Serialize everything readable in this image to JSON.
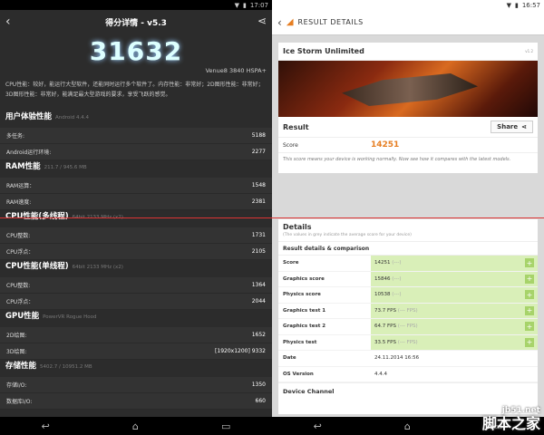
{
  "left": {
    "status_time": "17:07",
    "title": "得分详情 - v5.3",
    "score": "31632",
    "device": "Venue8 3840 HSPA+",
    "description": "CPU性能：较好，能运行大型软件，还能同时运行多个软件了。内存性能：非常好；2D图形性能：非常好；3D图形性能：非常好，能满足最大型游戏的要求，享受飞跃的感觉。",
    "sections": [
      {
        "title": "用户体验性能",
        "sub": "Android 4.4.4",
        "rows": [
          {
            "label": "多任务:",
            "value": "5188"
          },
          {
            "label": "Android运行环境:",
            "value": "2277"
          }
        ]
      },
      {
        "title": "RAM性能",
        "sub": "211.7 / 945.6 MB",
        "rows": [
          {
            "label": "RAM运算：",
            "value": "1548"
          },
          {
            "label": "RAM速度:",
            "value": "2381"
          }
        ]
      },
      {
        "title": "CPU性能(多线程)",
        "sub": "64bit 2133 MHz (x2)",
        "rows": [
          {
            "label": "CPU整数:",
            "value": "1731"
          },
          {
            "label": "CPU浮点：",
            "value": "2105"
          }
        ]
      },
      {
        "title": "CPU性能(单线程)",
        "sub": "64bit 2133 MHz (x2)",
        "rows": [
          {
            "label": "CPU整数:",
            "value": "1364"
          },
          {
            "label": "CPU浮点：",
            "value": "2044"
          }
        ]
      },
      {
        "title": "GPU性能",
        "sub": "PowerVR Rogue Hood",
        "rows": [
          {
            "label": "2D绘图:",
            "value": "1652"
          },
          {
            "label": "3D绘图:",
            "value": "[1920x1200] 9332"
          }
        ]
      },
      {
        "title": "存储性能",
        "sub": "5402.7 / 10951.2 MB",
        "rows": [
          {
            "label": "存储I/O:",
            "value": "1350"
          },
          {
            "label": "数据库I/O:",
            "value": "660"
          }
        ]
      }
    ]
  },
  "right": {
    "status_time": "16:57",
    "title": "RESULT DETAILS",
    "test_name": "Ice Storm Unlimited",
    "test_version": "v1.2",
    "result_label": "Result",
    "share_label": "Share",
    "score_label": "Score",
    "score_value": "14251",
    "score_note": "This score means your device is working normally. Now see how it compares with the latest models.",
    "details_title": "Details",
    "details_note": "(The values in grey indicate the average score for your device)",
    "details_sub": "Result details & comparison",
    "rows": [
      {
        "label": "Score",
        "value": "14251",
        "avg": "(---)",
        "highlight": true
      },
      {
        "label": "Graphics score",
        "value": "15846",
        "avg": "(---)",
        "highlight": true
      },
      {
        "label": "Physics score",
        "value": "10538",
        "avg": "(---)",
        "highlight": true
      },
      {
        "label": "Graphics test 1",
        "value": "73.7 FPS",
        "avg": "(--- FPS)",
        "highlight": true
      },
      {
        "label": "Graphics test 2",
        "value": "64.7 FPS",
        "avg": "(--- FPS)",
        "highlight": true
      },
      {
        "label": "Physics test",
        "value": "33.5 FPS",
        "avg": "(--- FPS)",
        "highlight": true
      },
      {
        "label": "Date",
        "value": "24.11.2014 16:56",
        "avg": "",
        "highlight": false
      },
      {
        "label": "OS Version",
        "value": "4.4.4",
        "avg": "",
        "highlight": false
      }
    ],
    "device_channel": "Device Channel"
  },
  "watermark": {
    "line1": "jb51.net",
    "line2": "脚本之家"
  },
  "colors": {
    "accent": "#e67e22",
    "highlight": "#d9efb8",
    "divider": "#dd3333"
  }
}
